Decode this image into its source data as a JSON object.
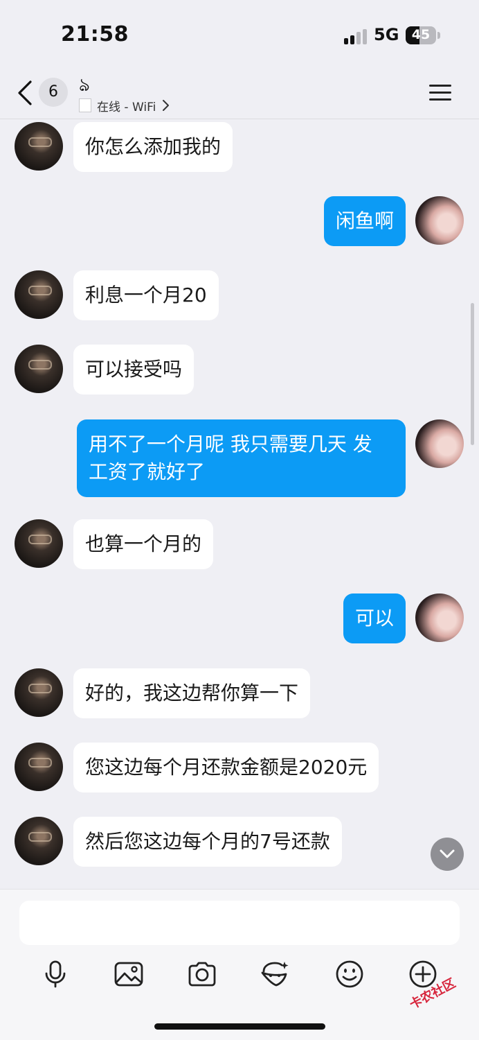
{
  "status_bar": {
    "time": "21:58",
    "network": "5G",
    "battery": "45"
  },
  "header": {
    "unread_count": "6",
    "contact_name": "ঌ",
    "status": "在线 - WiFi"
  },
  "messages": [
    {
      "side": "left",
      "text": "你怎么添加我的"
    },
    {
      "side": "right",
      "text": "闲鱼啊"
    },
    {
      "side": "left",
      "text": "利息一个月20"
    },
    {
      "side": "left",
      "text": "可以接受吗"
    },
    {
      "side": "right",
      "text": "用不了一个月呢 我只需要几天 发\n工资了就好了"
    },
    {
      "side": "left",
      "text": "也算一个月的"
    },
    {
      "side": "right",
      "text": "可以"
    },
    {
      "side": "left",
      "text": "好的，我这边帮你算一下"
    },
    {
      "side": "left",
      "text": "您这边每个月还款金额是2020元"
    },
    {
      "side": "left",
      "text": "然后您这边每个月的7号还款"
    }
  ],
  "toolbar": [
    "microphone-icon",
    "image-icon",
    "camera-icon",
    "sticker-icon",
    "emoji-icon",
    "plus-icon"
  ],
  "watermark": "卡农社区",
  "colors": {
    "sent_bubble": "#0c9bf5",
    "received_bubble": "#ffffff",
    "background": "#efeff4"
  }
}
